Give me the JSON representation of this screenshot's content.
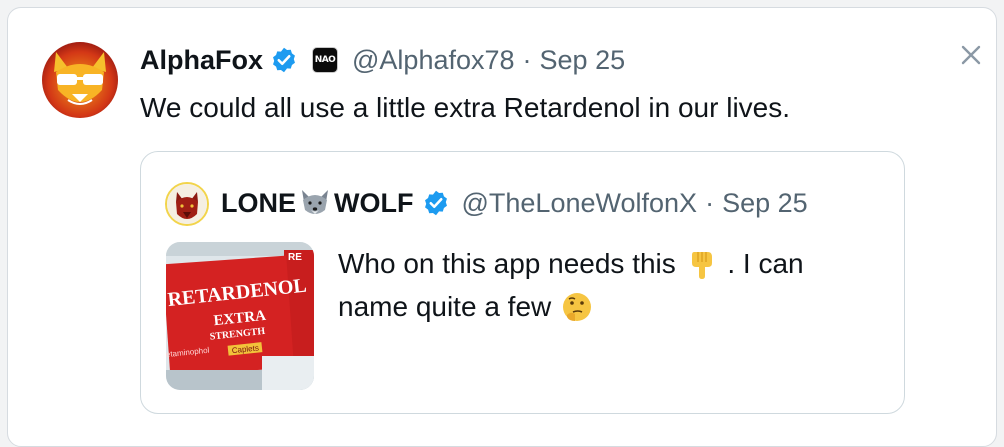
{
  "tweet": {
    "author_name": "AlphaFox",
    "handle": "@Alphafox78",
    "separator": "·",
    "date": "Sep 25",
    "affiliate_badge": "NAO",
    "text": "We could all use a little extra Retardenol in our lives."
  },
  "quoted": {
    "name_left": "LONE",
    "name_right": "WOLF",
    "handle": "@TheLoneWolfonX",
    "separator": "·",
    "date": "Sep 25",
    "text_part1": "Who on this app needs this",
    "text_part2": ".  I can name quite a few",
    "emoji_1": "pointing-down-emoji",
    "emoji_2": "thinking-face-emoji",
    "thumb_text": {
      "brand": "RETARDENOL",
      "line1": "EXTRA",
      "line2": "STRENGTH",
      "sub": "Caplets",
      "side": "etaminophol",
      "corner": "RE"
    }
  },
  "colors": {
    "verified": "#1d9bf0",
    "text": "#0f1419",
    "muted": "#536471",
    "border": "#cfd9de"
  }
}
